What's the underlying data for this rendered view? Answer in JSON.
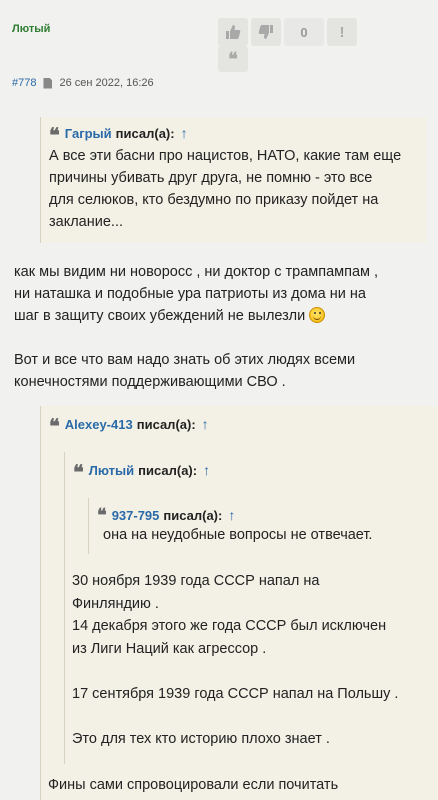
{
  "post": {
    "author": "Лютый",
    "number": "#778",
    "date": "26 сен 2022, 16:26",
    "vote_count": "0",
    "report_label": "!"
  },
  "quote1": {
    "author": "Гагрый",
    "said": "писал(а):",
    "arrow": "↑",
    "lines": [
      "А все эти басни про нацистов, НАТО, какие там еще",
      "причины убивать друг друга, не помню - это все",
      "для селюков, кто бездумно по приказу пойдет на",
      "заклание..."
    ]
  },
  "body": {
    "p1": [
      "как мы видим ни новоросс , ни доктор с трампампам ,",
      "ни наташка и подобные ура патриоты из дома ни на",
      "шаг в защиту своих убеждений не вылезли"
    ],
    "p2": [
      "Вот и все что вам надо знать об этих людях всеми",
      "конечностями поддерживающими СВО ."
    ]
  },
  "quote2": {
    "author": "Alexey-413",
    "said": "писал(а):",
    "arrow": "↑",
    "trailing": "Фины сами спровоцировали если почитать"
  },
  "quote3": {
    "author": "Лютый",
    "said": "писал(а):",
    "arrow": "↑",
    "lines": [
      "30 ноября 1939 года СССР напал на",
      "Финляндию .",
      "14 декабря этого же года СССР был исключен",
      "из Лиги Наций как агрессор .",
      "",
      "17 сентября 1939 года СССР напал на Польшу .",
      "",
      "Это для тех кто историю плохо знает ."
    ]
  },
  "quote4": {
    "author": "937-795",
    "said": "писал(а):",
    "arrow": "↑",
    "text": "она на неудобные вопросы не отвечает."
  },
  "icons": [
    "thumbs-up-icon",
    "thumbs-down-icon",
    "quote-icon",
    "document-icon",
    "smiley-icon"
  ]
}
